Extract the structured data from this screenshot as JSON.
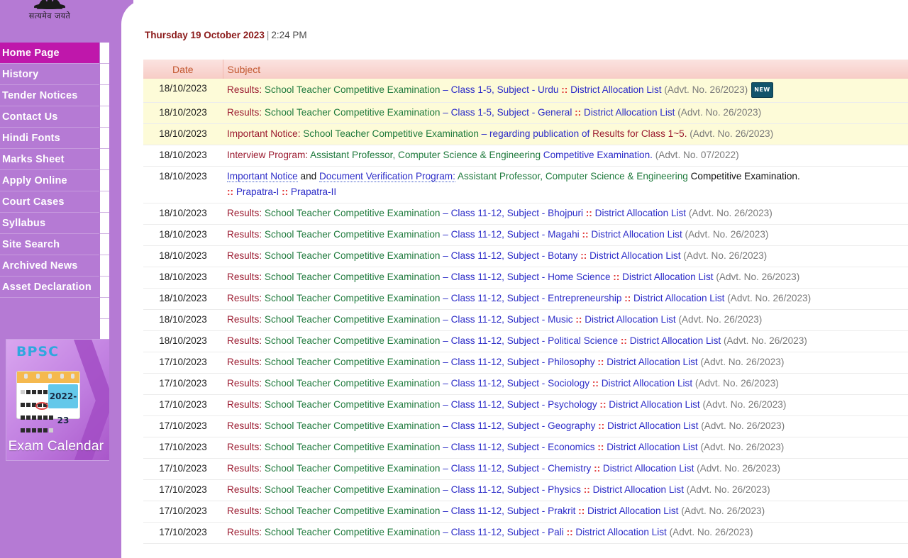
{
  "sidebar": {
    "emblem_motto": "सत्यमेव जयते",
    "items": [
      {
        "label": "Home Page",
        "active": true
      },
      {
        "label": "History",
        "active": false
      },
      {
        "label": "Tender Notices",
        "active": false
      },
      {
        "label": "Contact Us",
        "active": false
      },
      {
        "label": "Hindi Fonts",
        "active": false
      },
      {
        "label": "Marks Sheet",
        "active": false
      },
      {
        "label": "Apply Online",
        "active": false
      },
      {
        "label": "Court Cases",
        "active": false
      },
      {
        "label": "Syllabus",
        "active": false
      },
      {
        "label": "Site Search",
        "active": false
      },
      {
        "label": "Archived News",
        "active": false
      },
      {
        "label": "Asset Declaration",
        "active": false
      }
    ],
    "exam_calendar": {
      "brand": "BPSC",
      "year": "2022-23",
      "label": "Exam Calendar"
    }
  },
  "header": {
    "date": "Thursday 19 October 2023",
    "separator": "|",
    "time": "2:24 PM"
  },
  "table": {
    "columns": [
      "Date",
      "Subject"
    ],
    "rows": [
      {
        "date": "18/10/2023",
        "highlight": true,
        "type": "result",
        "prefix": "Results:",
        "exam": "School Teacher Competitive Examination",
        "dash": "–",
        "cls": "Class 1-5, Subject - Urdu",
        "colon": "::",
        "link": "District Allocation List",
        "advt": "(Advt. No. 26/2023)",
        "badge": "NEW"
      },
      {
        "date": "18/10/2023",
        "highlight": true,
        "type": "result",
        "prefix": "Results:",
        "exam": "School Teacher Competitive Examination",
        "dash": "–",
        "cls": "Class 1-5, Subject - General",
        "colon": "::",
        "link": "District Allocation List",
        "advt": "(Advt. No. 26/2023)",
        "badge": ""
      },
      {
        "date": "18/10/2023",
        "highlight": true,
        "type": "notice",
        "prefix": "Important Notice:",
        "exam": "School Teacher Competitive Examination",
        "dash": "–",
        "cls": "regarding publication of",
        "mid": "Results for Class 1~5.",
        "advt": "(Advt. No. 26/2023)"
      },
      {
        "date": "18/10/2023",
        "highlight": false,
        "type": "interview",
        "prefix": "Interview Program:",
        "exam": "Assistant Professor, Computer Science & Engineering",
        "link": "Competitive Examination.",
        "advt": "(Advt. No. 07/2022)"
      },
      {
        "date": "18/10/2023",
        "highlight": false,
        "type": "verify",
        "link1": "Important Notice",
        "and": "and",
        "link2": "Document Verification Program:",
        "exam": "Assistant Professor, Computer Science & Engineering",
        "tail": "Competitive Examination.",
        "colon1": "::",
        "p1": "Prapatra-I",
        "colon2": "::",
        "p2": "Prapatra-II"
      },
      {
        "date": "18/10/2023",
        "highlight": false,
        "type": "result",
        "prefix": "Results:",
        "exam": "School Teacher Competitive Examination",
        "dash": "–",
        "cls": "Class 11-12, Subject - Bhojpuri",
        "colon": "::",
        "link": "District Allocation List",
        "advt": "(Advt. No. 26/2023)",
        "badge": ""
      },
      {
        "date": "18/10/2023",
        "highlight": false,
        "type": "result",
        "prefix": "Results:",
        "exam": "School Teacher Competitive Examination",
        "dash": "–",
        "cls": "Class 11-12, Subject - Magahi",
        "colon": "::",
        "link": "District Allocation List",
        "advt": "(Advt. No. 26/2023)",
        "badge": ""
      },
      {
        "date": "18/10/2023",
        "highlight": false,
        "type": "result",
        "prefix": "Results:",
        "exam": "School Teacher Competitive Examination",
        "dash": "–",
        "cls": "Class 11-12, Subject - Botany",
        "colon": "::",
        "link": "District Allocation List",
        "advt": "(Advt. No. 26/2023)",
        "badge": ""
      },
      {
        "date": "18/10/2023",
        "highlight": false,
        "type": "result",
        "prefix": "Results:",
        "exam": "School Teacher Competitive Examination",
        "dash": "–",
        "cls": "Class 11-12, Subject - Home Science",
        "colon": "::",
        "link": "District Allocation List",
        "advt": "(Advt. No. 26/2023)",
        "badge": ""
      },
      {
        "date": "18/10/2023",
        "highlight": false,
        "type": "result",
        "prefix": "Results:",
        "exam": "School Teacher Competitive Examination",
        "dash": "–",
        "cls": "Class 11-12, Subject - Entrepreneurship",
        "colon": "::",
        "link": "District Allocation List",
        "advt": "(Advt. No. 26/2023)",
        "badge": ""
      },
      {
        "date": "18/10/2023",
        "highlight": false,
        "type": "result",
        "prefix": "Results:",
        "exam": "School Teacher Competitive Examination",
        "dash": "–",
        "cls": "Class 11-12, Subject - Music",
        "colon": "::",
        "link": "District Allocation List",
        "advt": "(Advt. No. 26/2023)",
        "badge": ""
      },
      {
        "date": "18/10/2023",
        "highlight": false,
        "type": "result",
        "prefix": "Results:",
        "exam": "School Teacher Competitive Examination",
        "dash": "–",
        "cls": "Class 11-12, Subject - Political Science",
        "colon": "::",
        "link": "District Allocation List",
        "advt": "(Advt. No. 26/2023)",
        "badge": ""
      },
      {
        "date": "17/10/2023",
        "highlight": false,
        "type": "result",
        "prefix": "Results:",
        "exam": "School Teacher Competitive Examination",
        "dash": "–",
        "cls": "Class 11-12, Subject - Philosophy",
        "colon": "::",
        "link": "District Allocation List",
        "advt": "(Advt. No. 26/2023)",
        "badge": ""
      },
      {
        "date": "17/10/2023",
        "highlight": false,
        "type": "result",
        "prefix": "Results:",
        "exam": "School Teacher Competitive Examination",
        "dash": "–",
        "cls": "Class 11-12, Subject - Sociology",
        "colon": "::",
        "link": "District Allocation List",
        "advt": "(Advt. No. 26/2023)",
        "badge": ""
      },
      {
        "date": "17/10/2023",
        "highlight": false,
        "type": "result",
        "prefix": "Results:",
        "exam": "School Teacher Competitive Examination",
        "dash": "–",
        "cls": "Class 11-12, Subject - Psychology",
        "colon": "::",
        "link": "District Allocation List",
        "advt": "(Advt. No. 26/2023)",
        "badge": ""
      },
      {
        "date": "17/10/2023",
        "highlight": false,
        "type": "result",
        "prefix": "Results:",
        "exam": "School Teacher Competitive Examination",
        "dash": "–",
        "cls": "Class 11-12, Subject - Geography",
        "colon": "::",
        "link": "District Allocation List",
        "advt": "(Advt. No. 26/2023)",
        "badge": ""
      },
      {
        "date": "17/10/2023",
        "highlight": false,
        "type": "result",
        "prefix": "Results:",
        "exam": "School Teacher Competitive Examination",
        "dash": "–",
        "cls": "Class 11-12, Subject - Economics",
        "colon": "::",
        "link": "District Allocation List",
        "advt": "(Advt. No. 26/2023)",
        "badge": ""
      },
      {
        "date": "17/10/2023",
        "highlight": false,
        "type": "result",
        "prefix": "Results:",
        "exam": "School Teacher Competitive Examination",
        "dash": "–",
        "cls": "Class 11-12, Subject - Chemistry",
        "colon": "::",
        "link": "District Allocation List",
        "advt": "(Advt. No. 26/2023)",
        "badge": ""
      },
      {
        "date": "17/10/2023",
        "highlight": false,
        "type": "result",
        "prefix": "Results:",
        "exam": "School Teacher Competitive Examination",
        "dash": "–",
        "cls": "Class 11-12, Subject - Physics",
        "colon": "::",
        "link": "District Allocation List",
        "advt": "(Advt. No. 26/2023)",
        "badge": ""
      },
      {
        "date": "17/10/2023",
        "highlight": false,
        "type": "result",
        "prefix": "Results:",
        "exam": "School Teacher Competitive Examination",
        "dash": "–",
        "cls": "Class 11-12, Subject - Prakrit",
        "colon": "::",
        "link": "District Allocation List",
        "advt": "(Advt. No. 26/2023)",
        "badge": ""
      },
      {
        "date": "17/10/2023",
        "highlight": false,
        "type": "result",
        "prefix": "Results:",
        "exam": "School Teacher Competitive Examination",
        "dash": "–",
        "cls": "Class 11-12, Subject - Pali",
        "colon": "::",
        "link": "District Allocation List",
        "advt": "(Advt. No. 26/2023)",
        "badge": ""
      }
    ]
  },
  "colors": {
    "sidebar_purple": "#b57ad4",
    "active_menu": "#bf17ab",
    "row_highlight": "#fdfbd8",
    "header_pink": "#f7ccc6",
    "link_blue": "#2c2cc8",
    "exam_green": "#1f7a3d",
    "prefix_maroon": "#9b1b30",
    "advt_grey": "#7a7a7a",
    "badge_teal": "#12536b"
  }
}
